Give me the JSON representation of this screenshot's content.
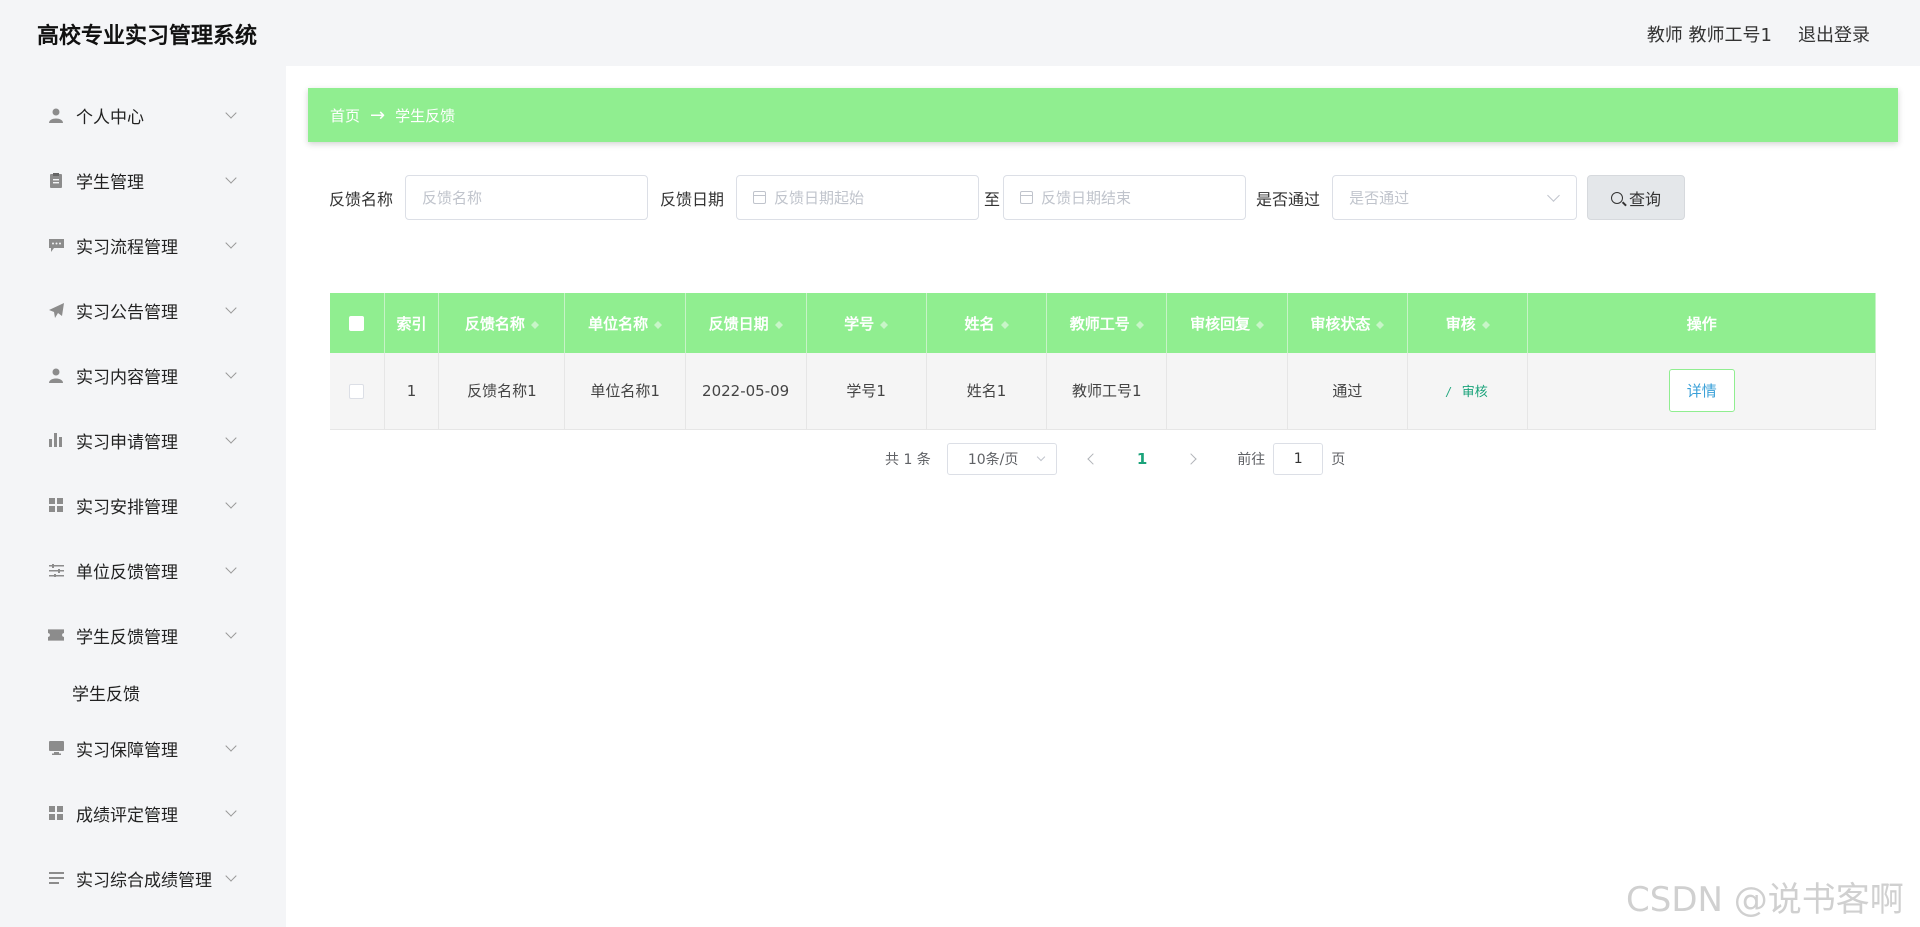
{
  "app": {
    "title": "高校专业实习管理系统"
  },
  "header": {
    "user": "教师 教师工号1",
    "logout": "退出登录"
  },
  "sidebar": {
    "items": [
      {
        "label": "个人中心",
        "icon": "user-icon"
      },
      {
        "label": "学生管理",
        "icon": "clipboard-icon"
      },
      {
        "label": "实习流程管理",
        "icon": "message-icon"
      },
      {
        "label": "实习公告管理",
        "icon": "send-icon"
      },
      {
        "label": "实习内容管理",
        "icon": "user-icon"
      },
      {
        "label": "实习申请管理",
        "icon": "bar-chart-icon"
      },
      {
        "label": "实习安排管理",
        "icon": "grid-icon"
      },
      {
        "label": "单位反馈管理",
        "icon": "sliders-icon"
      },
      {
        "label": "学生反馈管理",
        "icon": "ticket-icon"
      },
      {
        "label": "实习保障管理",
        "icon": "monitor-icon"
      },
      {
        "label": "成绩评定管理",
        "icon": "grid-icon"
      },
      {
        "label": "实习综合成绩管理",
        "icon": "list-icon"
      }
    ],
    "submenu": {
      "label": "学生反馈"
    }
  },
  "breadcrumb": {
    "home": "首页",
    "arrow": "→",
    "current": "学生反馈"
  },
  "search": {
    "name_label": "反馈名称",
    "name_placeholder": "反馈名称",
    "date_label": "反馈日期",
    "date_start_placeholder": "反馈日期起始",
    "date_sep": "至",
    "date_end_placeholder": "反馈日期结束",
    "pass_label": "是否通过",
    "pass_placeholder": "是否通过",
    "button": "查询"
  },
  "table": {
    "columns": [
      "索引",
      "反馈名称",
      "单位名称",
      "反馈日期",
      "学号",
      "姓名",
      "教师工号",
      "审核回复",
      "审核状态",
      "审核",
      "操作"
    ],
    "rows": [
      {
        "index": "1",
        "feedback_name": "反馈名称1",
        "unit_name": "单位名称1",
        "date": "2022-05-09",
        "student_no": "学号1",
        "name": "姓名1",
        "teacher_no": "教师工号1",
        "reply": "",
        "status": "通过",
        "audit": "审核",
        "action": "详情"
      }
    ]
  },
  "pagination": {
    "total": "共 1 条",
    "page_size": "10条/页",
    "current": "1",
    "goto_label": "前往",
    "goto_value": "1",
    "page_suffix": "页"
  },
  "watermark": "CSDN @说书客啊",
  "colors": {
    "accent": "#90ee90",
    "link": "#1aa37a",
    "detail_text": "#3aa0d8"
  }
}
